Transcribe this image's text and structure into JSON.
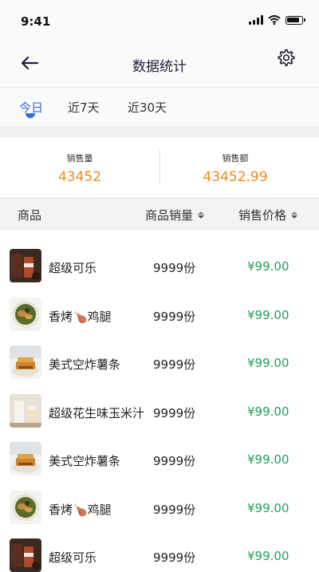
{
  "status_bar": {
    "time": "9:41"
  },
  "nav": {
    "title": "数据统计"
  },
  "tabs": [
    {
      "label": "今日",
      "active": true
    },
    {
      "label": "近7天",
      "active": false
    },
    {
      "label": "近30天",
      "active": false
    }
  ],
  "summary": {
    "sales_count_label": "销售量",
    "sales_count_value": "43452",
    "sales_amount_label": "销售额",
    "sales_amount_value": "43452.99"
  },
  "table": {
    "headers": {
      "product": "商品",
      "quantity": "商品销量",
      "price": "销售价格"
    },
    "rows": [
      {
        "name": "超级可乐",
        "qty": "9999份",
        "price": "¥99.00",
        "image": "cola"
      },
      {
        "name": "香烤🍗鸡腿",
        "qty": "9999份",
        "price": "¥99.00",
        "image": "chicken"
      },
      {
        "name": "美式空炸薯条",
        "qty": "9999份",
        "price": "¥99.00",
        "image": "fries"
      },
      {
        "name": "超级花生味玉米汁",
        "qty": "9999份",
        "price": "¥99.00",
        "image": "corn-juice"
      },
      {
        "name": "美式空炸薯条",
        "qty": "9999份",
        "price": "¥99.00",
        "image": "fries"
      },
      {
        "name": "香烤🍗鸡腿",
        "qty": "9999份",
        "price": "¥99.00",
        "image": "chicken"
      },
      {
        "name": "超级可乐",
        "qty": "9999份",
        "price": "¥99.00",
        "image": "cola"
      }
    ]
  },
  "colors": {
    "accent": "#2d6cdf",
    "summary_value": "#f08a1c",
    "price": "#1fa05a"
  },
  "icons": [
    "back-arrow-icon",
    "settings-gear-icon",
    "sort-icon"
  ]
}
